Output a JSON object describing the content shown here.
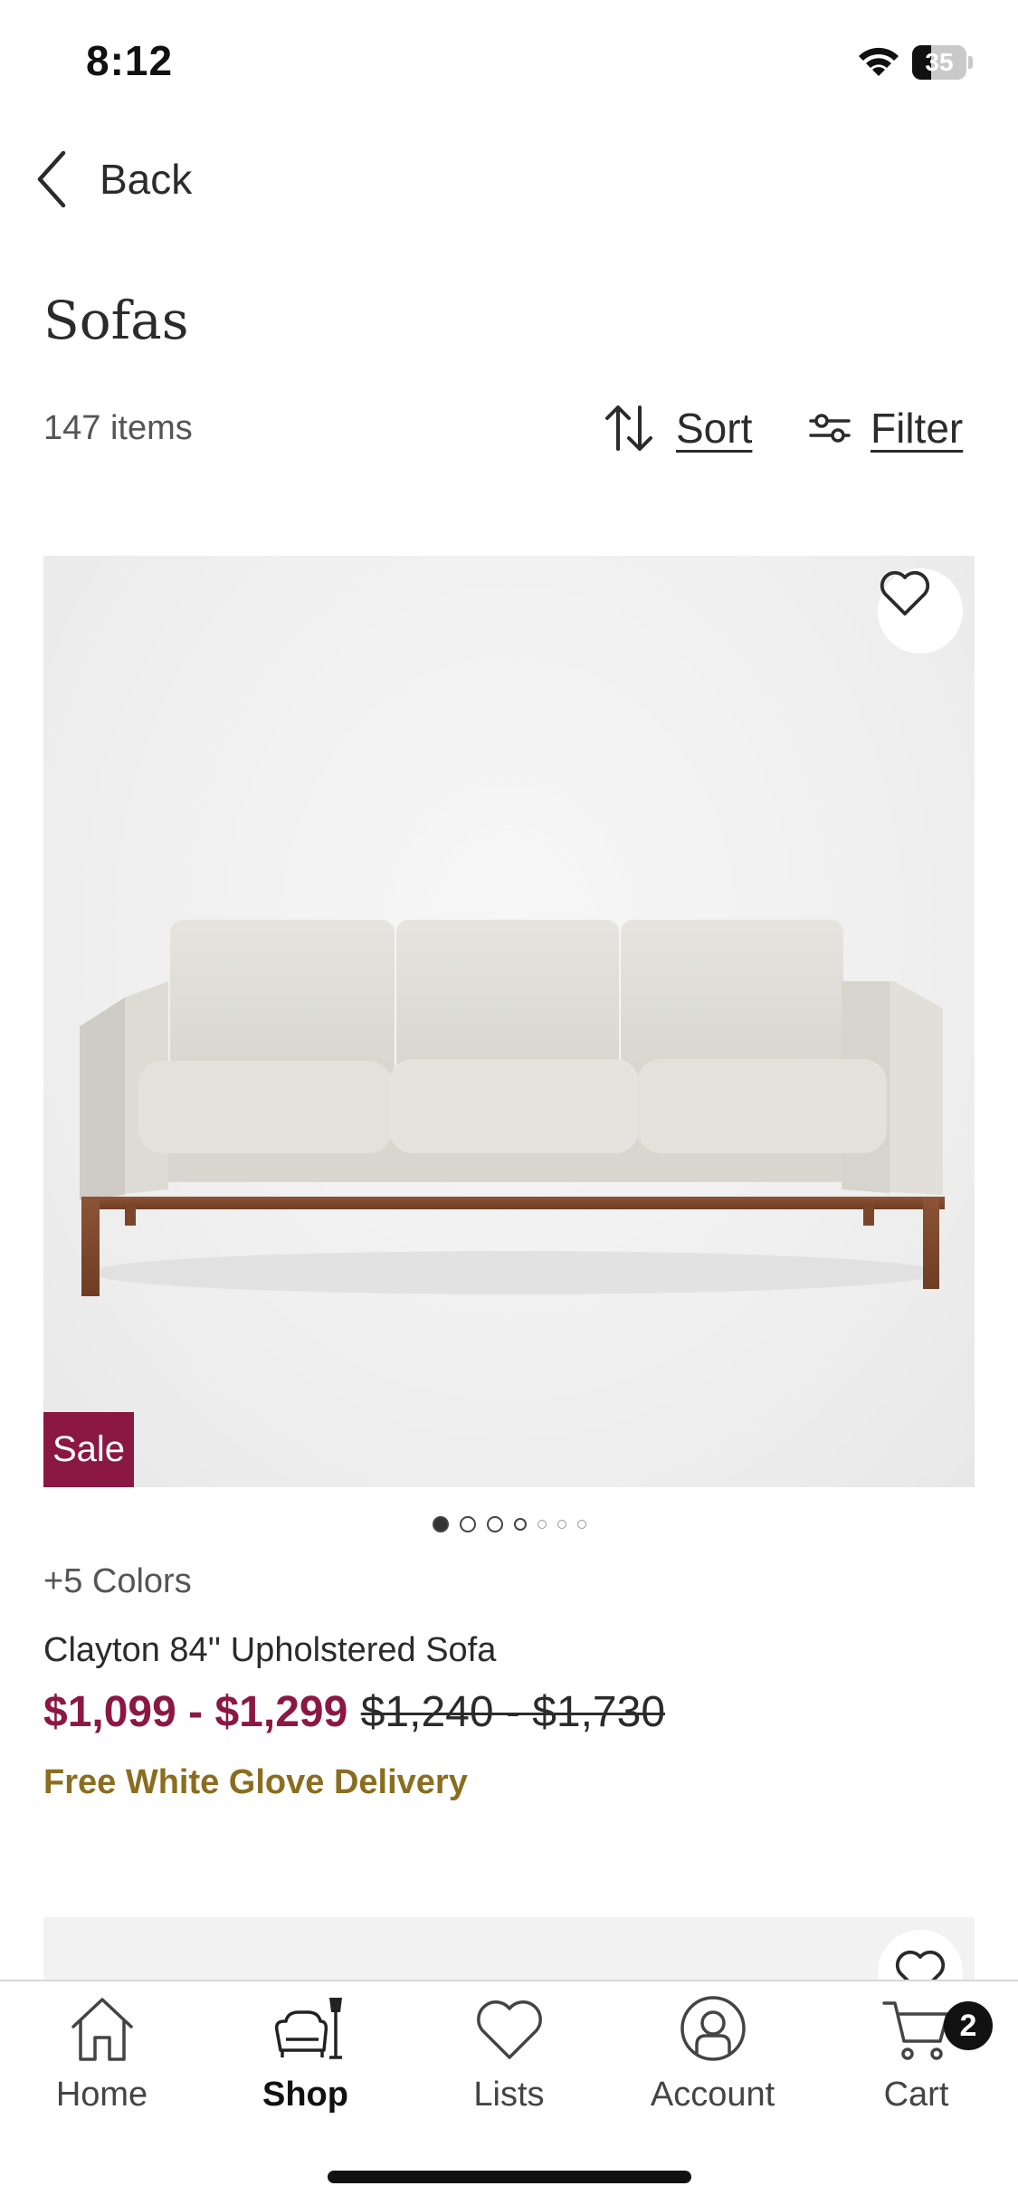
{
  "status_bar": {
    "time": "8:12",
    "battery": "35",
    "battery_level": 0.35
  },
  "header": {
    "back_label": "Back",
    "title": "Sofas"
  },
  "toolbar": {
    "item_count": "147 items",
    "sort_label": "Sort",
    "filter_label": "Filter"
  },
  "product": {
    "badge": "Sale",
    "colors": "+5 Colors",
    "name": "Clayton 84'' Upholstered Sofa",
    "sale_price": "$1,099 - $1,299",
    "original_price": "$1,240 - $1,730",
    "delivery": "Free White Glove Delivery",
    "image_count": 7,
    "active_image": 0,
    "colors_theme": {
      "sale": "#8b1842",
      "delivery": "#8a6d1f"
    }
  },
  "tab_bar": {
    "tabs": [
      {
        "label": "Home",
        "icon": "home-icon"
      },
      {
        "label": "Shop",
        "icon": "shop-icon"
      },
      {
        "label": "Lists",
        "icon": "heart-icon"
      },
      {
        "label": "Account",
        "icon": "account-icon"
      },
      {
        "label": "Cart",
        "icon": "cart-icon"
      }
    ],
    "active": "Shop",
    "cart_count": "2"
  }
}
